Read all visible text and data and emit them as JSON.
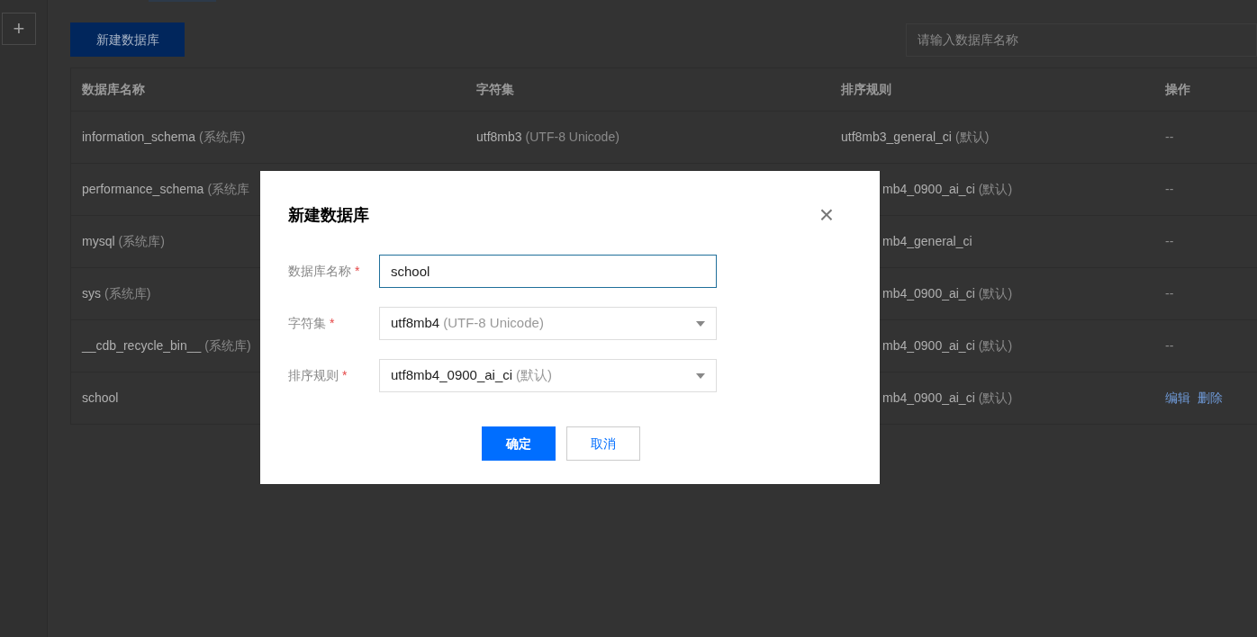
{
  "sidebar": {
    "add_button": "+"
  },
  "toolbar": {
    "create_button": "新建数据库",
    "search": {
      "placeholder": "请输入数据库名称"
    }
  },
  "table": {
    "columns": [
      "数据库名称",
      "字符集",
      "排序规则",
      "操作"
    ],
    "rows": [
      {
        "name": "information_schema",
        "name_note": "(系统库)",
        "charset": "utf8mb3",
        "charset_note": "(UTF-8 Unicode)",
        "collation": "utf8mb3_general_ci",
        "collation_note": "(默认)",
        "actions": [
          "--"
        ]
      },
      {
        "name": "performance_schema",
        "name_note": "(系统库",
        "collation": "mb4_0900_ai_ci",
        "collation_note": "(默认)",
        "actions": [
          "--"
        ]
      },
      {
        "name": "mysql",
        "name_note": "(系统库)",
        "collation": "mb4_general_ci",
        "actions": [
          "--"
        ]
      },
      {
        "name": "sys",
        "name_note": "(系统库)",
        "collation": "mb4_0900_ai_ci",
        "collation_note": "(默认)",
        "actions": [
          "--"
        ]
      },
      {
        "name": "__cdb_recycle_bin__",
        "name_note": "(系统库)",
        "collation": "mb4_0900_ai_ci",
        "collation_note": "(默认)",
        "actions": [
          "--"
        ]
      },
      {
        "name": "school",
        "collation": "mb4_0900_ai_ci",
        "collation_note": "(默认)",
        "actions": [
          "编辑",
          "删除"
        ]
      }
    ]
  },
  "dialog": {
    "title": "新建数据库",
    "close": "×",
    "fields": [
      {
        "kind": "input",
        "label": "数据库名称",
        "required_mark": "*",
        "value": "school",
        "focused": true
      },
      {
        "kind": "select",
        "label": "字符集",
        "required_mark": "*",
        "value": "utf8mb4",
        "note": "(UTF-8 Unicode)",
        "focused": false
      },
      {
        "kind": "select",
        "label": "排序规则",
        "required_mark": "*",
        "value": "utf8mb4_0900_ai_ci",
        "note": "(默认)",
        "focused": false
      }
    ],
    "buttons": [
      {
        "label": "确定",
        "primary": true
      },
      {
        "label": "取消",
        "primary": false
      }
    ]
  }
}
